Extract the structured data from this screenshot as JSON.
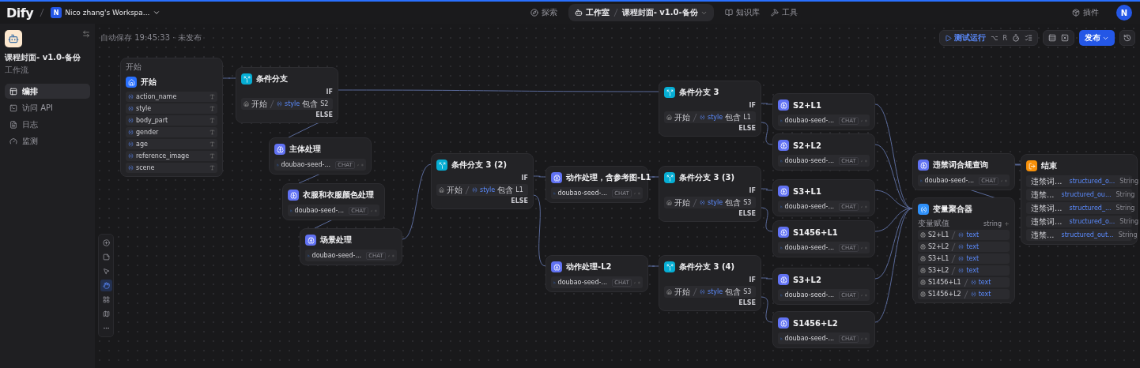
{
  "topbar": {
    "brand": "Dify",
    "workspace": {
      "initial": "N",
      "name": "Nico zhang's Workspa..."
    },
    "nav": [
      {
        "label": "探索",
        "selected": false
      },
      {
        "label": "工作室",
        "selected": true
      },
      {
        "label": "知识库",
        "selected": false
      },
      {
        "label": "工具",
        "selected": false
      }
    ],
    "breadcrumb": "课程封面- v1.0-备份",
    "plugins": "插件",
    "avatar": "N"
  },
  "sidebar": {
    "app": {
      "name": "课程封面- v1.0-备份",
      "type": "工作流"
    },
    "menu": [
      {
        "label": "编排",
        "selected": true
      },
      {
        "label": "访问 API",
        "selected": false
      },
      {
        "label": "日志",
        "selected": false
      },
      {
        "label": "监测",
        "selected": false
      }
    ]
  },
  "canvas": {
    "autosave": "自动保存 19:45:33 · 未发布",
    "toolbar": {
      "run": "测试运行",
      "shortcut": [
        "⌥",
        "R"
      ],
      "publish": "发布"
    },
    "tools": [
      {
        "kind": "add",
        "selected": false
      },
      {
        "kind": "note",
        "selected": false
      },
      {
        "kind": "pointer",
        "selected": false
      },
      {
        "kind": "hand",
        "selected": true
      },
      {
        "kind": "organize",
        "selected": false
      },
      {
        "kind": "minimap",
        "selected": false
      },
      {
        "kind": "more",
        "selected": false
      }
    ],
    "nodes": [
      {
        "kind": "start",
        "caption": "开始",
        "title": "开始",
        "variables": [
          "action_name",
          "style",
          "body_part",
          "gender",
          "age",
          "reference_image",
          "scene"
        ]
      },
      {
        "kind": "if_else",
        "title": "条件分支",
        "if_label": "IF",
        "else_label": "ELSE",
        "condition": {
          "node": "开始",
          "variable": "style",
          "operator": "包含",
          "value": "S2"
        }
      },
      {
        "kind": "llm",
        "title": "主体处理",
        "model": "doubao-seed-...",
        "mode": "CHAT"
      },
      {
        "kind": "llm",
        "title": "衣服和衣服颜色处理",
        "model": "doubao-seed-...",
        "mode": "CHAT"
      },
      {
        "kind": "llm",
        "title": "场景处理",
        "model": "doubao-seed-...",
        "mode": "CHAT"
      },
      {
        "kind": "if_else",
        "title": "条件分支 3 (2)",
        "if_label": "IF",
        "else_label": "ELSE",
        "condition": {
          "node": "开始",
          "variable": "style",
          "operator": "包含",
          "value": "L1"
        }
      },
      {
        "kind": "llm",
        "title": "动作处理，含参考图-L1",
        "model": "doubao-seed-...",
        "mode": "CHAT"
      },
      {
        "kind": "llm",
        "title": "动作处理-L2",
        "model": "doubao-seed-...",
        "mode": "CHAT"
      },
      {
        "kind": "if_else",
        "title": "条件分支 3",
        "if_label": "IF",
        "else_label": "ELSE",
        "condition": {
          "node": "开始",
          "variable": "style",
          "operator": "包含",
          "value": "L1"
        }
      },
      {
        "kind": "if_else",
        "title": "条件分支 3 (3)",
        "if_label": "IF",
        "else_label": "ELSE",
        "condition": {
          "node": "开始",
          "variable": "style",
          "operator": "包含",
          "value": "S3"
        }
      },
      {
        "kind": "if_else",
        "title": "条件分支 3 (4)",
        "if_label": "IF",
        "else_label": "ELSE",
        "condition": {
          "node": "开始",
          "variable": "style",
          "operator": "包含",
          "value": "S3"
        }
      },
      {
        "kind": "llm",
        "title": "S2+L1",
        "model": "doubao-seed-...",
        "mode": "CHAT"
      },
      {
        "kind": "llm",
        "title": "S2+L2",
        "model": "doubao-seed-...",
        "mode": "CHAT"
      },
      {
        "kind": "llm",
        "title": "S3+L1",
        "model": "doubao-seed-...",
        "mode": "CHAT"
      },
      {
        "kind": "llm",
        "title": "S1456+L1",
        "model": "doubao-seed-...",
        "mode": "CHAT"
      },
      {
        "kind": "llm",
        "title": "S3+L2",
        "model": "doubao-seed-...",
        "mode": "CHAT"
      },
      {
        "kind": "llm",
        "title": "S1456+L2",
        "model": "doubao-seed-...",
        "mode": "CHAT"
      },
      {
        "kind": "llm",
        "title": "违禁词合规查询",
        "model": "doubao-seed-...",
        "mode": "CHAT"
      },
      {
        "kind": "aggregator",
        "title": "变量聚合器",
        "group": "变量赋值",
        "type": "string",
        "items": [
          {
            "node": "S2+L1",
            "variable": "text"
          },
          {
            "node": "S2+L2",
            "variable": "text"
          },
          {
            "node": "S3+L1",
            "variable": "text"
          },
          {
            "node": "S3+L2",
            "variable": "text"
          },
          {
            "node": "S1456+L1",
            "variable": "text"
          },
          {
            "node": "S1456+L2",
            "variable": "text"
          }
        ]
      },
      {
        "kind": "end",
        "title": "结束",
        "outputs": [
          {
            "node": "违禁词...",
            "variable": "structured_o...",
            "type": "String"
          },
          {
            "node": "违禁...",
            "variable": "structured_ou...",
            "type": "String"
          },
          {
            "node": "违禁词...",
            "variable": "structured_...",
            "type": "String"
          },
          {
            "node": "违禁词...",
            "variable": "structured_o...",
            "type": "String"
          },
          {
            "node": "违禁...",
            "variable": "structured_out...",
            "type": "String"
          }
        ]
      }
    ]
  }
}
